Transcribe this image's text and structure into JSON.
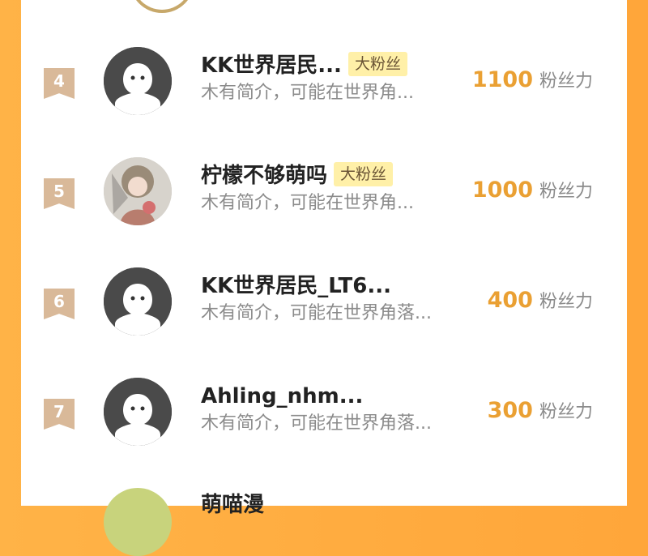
{
  "unit_label": "粉丝力",
  "rows": [
    {
      "rank": "4",
      "name": "KK世界居民...",
      "badge": "大粉丝",
      "bio": "木有简介，可能在世界角...",
      "count": "1100",
      "avatar": "default"
    },
    {
      "rank": "5",
      "name": "柠檬不够萌吗",
      "badge": "大粉丝",
      "bio": "木有简介，可能在世界角...",
      "count": "1000",
      "avatar": "illustration"
    },
    {
      "rank": "6",
      "name": "KK世界居民_LT6...",
      "badge": "",
      "bio": "木有简介，可能在世界角落...",
      "count": "400",
      "avatar": "default"
    },
    {
      "rank": "7",
      "name": "Ahling_nhm...",
      "badge": "",
      "bio": "木有简介，可能在世界角落...",
      "count": "300",
      "avatar": "default"
    }
  ],
  "partial_row": {
    "name": "萌喵漫"
  },
  "colors": {
    "accent": "#EAA033",
    "badge_bg": "#FFF0A8",
    "rank_bg": "#D9B999",
    "background": "#FFA63A"
  }
}
